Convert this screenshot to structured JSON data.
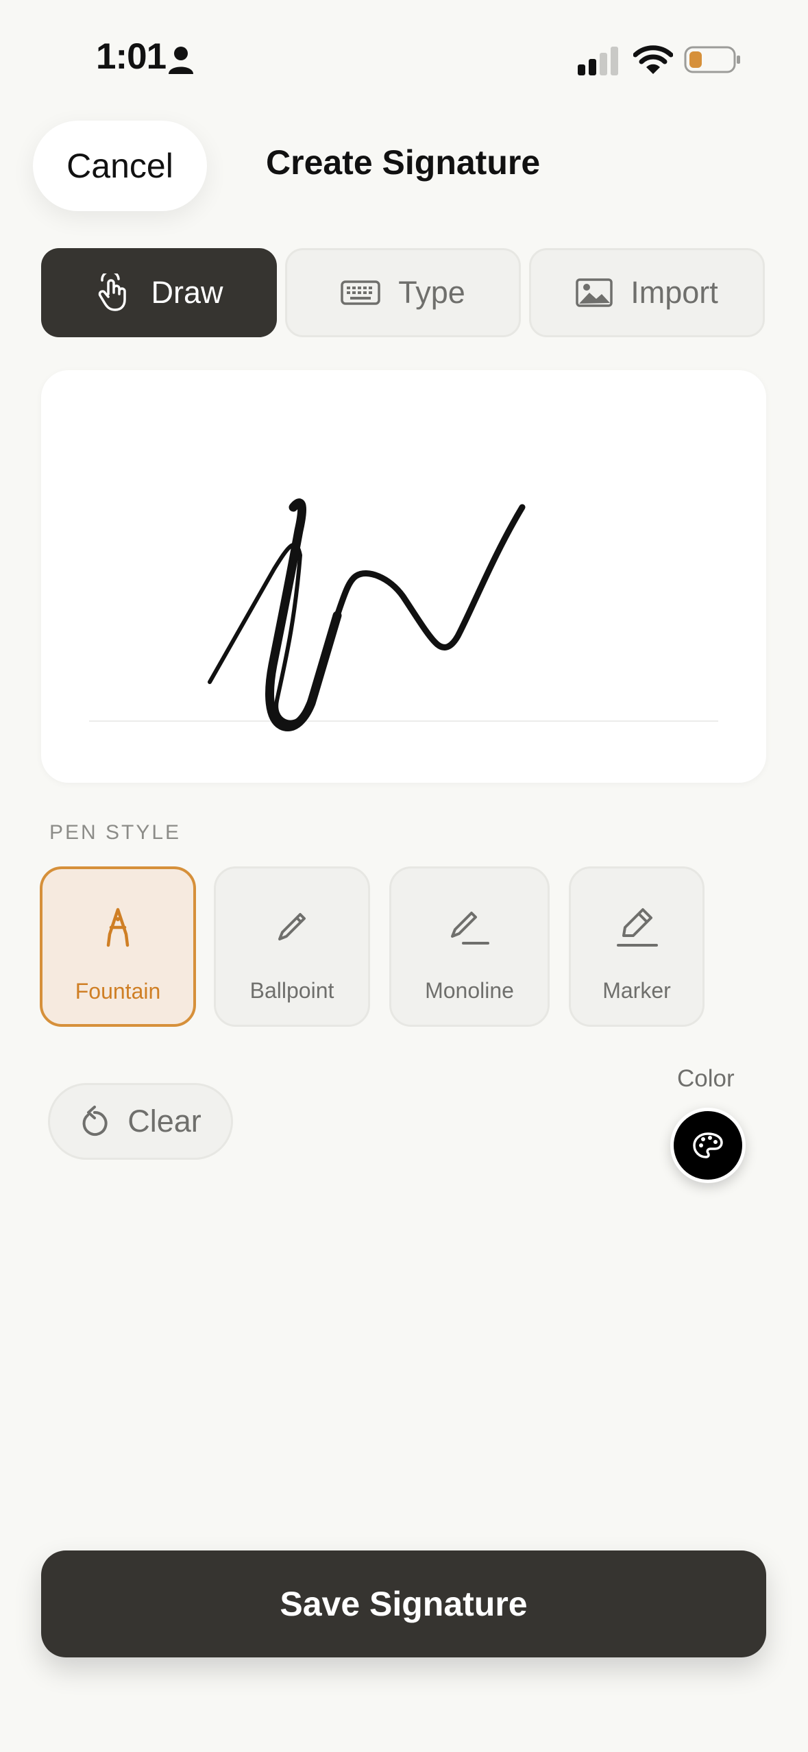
{
  "status_bar": {
    "time": "1:01"
  },
  "header": {
    "cancel_label": "Cancel",
    "title": "Create Signature"
  },
  "mode_tabs": [
    {
      "label": "Draw",
      "icon": "hand-draw-icon",
      "selected": true
    },
    {
      "label": "Type",
      "icon": "keyboard-icon",
      "selected": false
    },
    {
      "label": "Import",
      "icon": "image-icon",
      "selected": false
    }
  ],
  "pen_style": {
    "section_label": "PEN STYLE",
    "options": [
      {
        "label": "Fountain",
        "icon": "fountain-pen-icon",
        "selected": true
      },
      {
        "label": "Ballpoint",
        "icon": "pencil-icon",
        "selected": false
      },
      {
        "label": "Monoline",
        "icon": "monoline-pen-icon",
        "selected": false
      },
      {
        "label": "Marker",
        "icon": "marker-icon",
        "selected": false
      }
    ]
  },
  "actions": {
    "clear_label": "Clear",
    "color_label": "Color",
    "current_color": "#000000"
  },
  "footer": {
    "save_label": "Save Signature"
  },
  "colors": {
    "accent": "#d6903a",
    "dark": "#363430",
    "background": "#f8f8f5",
    "battery_fill": "#d6903a"
  }
}
